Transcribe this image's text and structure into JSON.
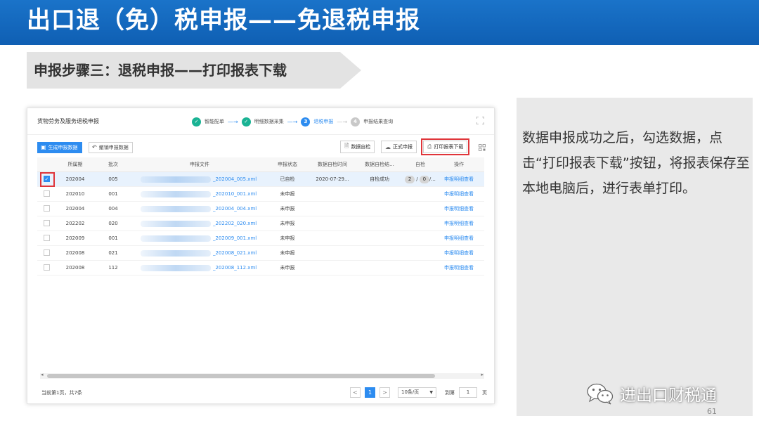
{
  "slide": {
    "title": "出口退（免）税申报——免退税申报",
    "step_title": "申报步骤三：退税申报——打印报表下载",
    "page_number": "61"
  },
  "app": {
    "title": "货物劳务及服务退税申报",
    "wizard_steps": [
      {
        "index": "✓",
        "label": "智能配单",
        "state": "done"
      },
      {
        "index": "✓",
        "label": "明细数据采集",
        "state": "done"
      },
      {
        "index": "3",
        "label": "退税申报",
        "state": "active"
      },
      {
        "index": "4",
        "label": "申报结果查询",
        "state": "todo"
      }
    ],
    "tabs": {
      "generate": "生成申报数据",
      "revoke": "撤销申报数据"
    },
    "toolbar": {
      "self_check": "数据自检",
      "formal_declare": "正式申报",
      "print_download": "打印报表下载"
    },
    "table": {
      "headers": [
        "所属期",
        "批次",
        "申报文件",
        "申报状态",
        "数据自检时间",
        "数据自检结...",
        "自检",
        "操作"
      ],
      "rows": [
        {
          "period": "202004",
          "batch": "005",
          "file": "_202004_005.xml",
          "status": "已自检",
          "check_time": "2020-07-29...",
          "check_result": "自检成功",
          "check_a": "2",
          "check_b": "0",
          "check_more": "/...",
          "action": "申报明细查看",
          "checked": true
        },
        {
          "period": "202010",
          "batch": "001",
          "file": "_202010_001.xml",
          "status": "未申报",
          "check_time": "",
          "check_result": "",
          "check_a": "",
          "check_b": "",
          "check_more": "",
          "action": "申报明细查看",
          "checked": false
        },
        {
          "period": "202004",
          "batch": "004",
          "file": "_202004_004.xml",
          "status": "未申报",
          "check_time": "",
          "check_result": "",
          "check_a": "",
          "check_b": "",
          "check_more": "",
          "action": "申报明细查看",
          "checked": false
        },
        {
          "period": "202202",
          "batch": "020",
          "file": "_202202_020.xml",
          "status": "未申报",
          "check_time": "",
          "check_result": "",
          "check_a": "",
          "check_b": "",
          "check_more": "",
          "action": "申报明细查看",
          "checked": false
        },
        {
          "period": "202009",
          "batch": "001",
          "file": "_202009_001.xml",
          "status": "未申报",
          "check_time": "",
          "check_result": "",
          "check_a": "",
          "check_b": "",
          "check_more": "",
          "action": "申报明细查看",
          "checked": false
        },
        {
          "period": "202008",
          "batch": "021",
          "file": "_202008_021.xml",
          "status": "未申报",
          "check_time": "",
          "check_result": "",
          "check_a": "",
          "check_b": "",
          "check_more": "",
          "action": "申报明细查看",
          "checked": false
        },
        {
          "period": "202008",
          "batch": "112",
          "file": "_202008_112.xml",
          "status": "未申报",
          "check_time": "",
          "check_result": "",
          "check_a": "",
          "check_b": "",
          "check_more": "",
          "action": "申报明细查看",
          "checked": false
        }
      ]
    },
    "pager": {
      "info": "当前第1页，共7条",
      "prev": "<",
      "current": "1",
      "next": ">",
      "page_size": "10条/页",
      "goto_label": "到第",
      "goto_value": "1",
      "page_suffix": "页"
    }
  },
  "note": {
    "text": "数据申报成功之后，勾选数据，点击“打印报表下载”按钮，将报表保存至本地电脑后，进行表单打印。"
  },
  "watermark": {
    "text": "进出口财税通"
  },
  "colors": {
    "header_blue": "#1a73c9",
    "accent_blue": "#2d8cf0",
    "done_green": "#1ab394",
    "highlight_red": "#e0353a"
  }
}
